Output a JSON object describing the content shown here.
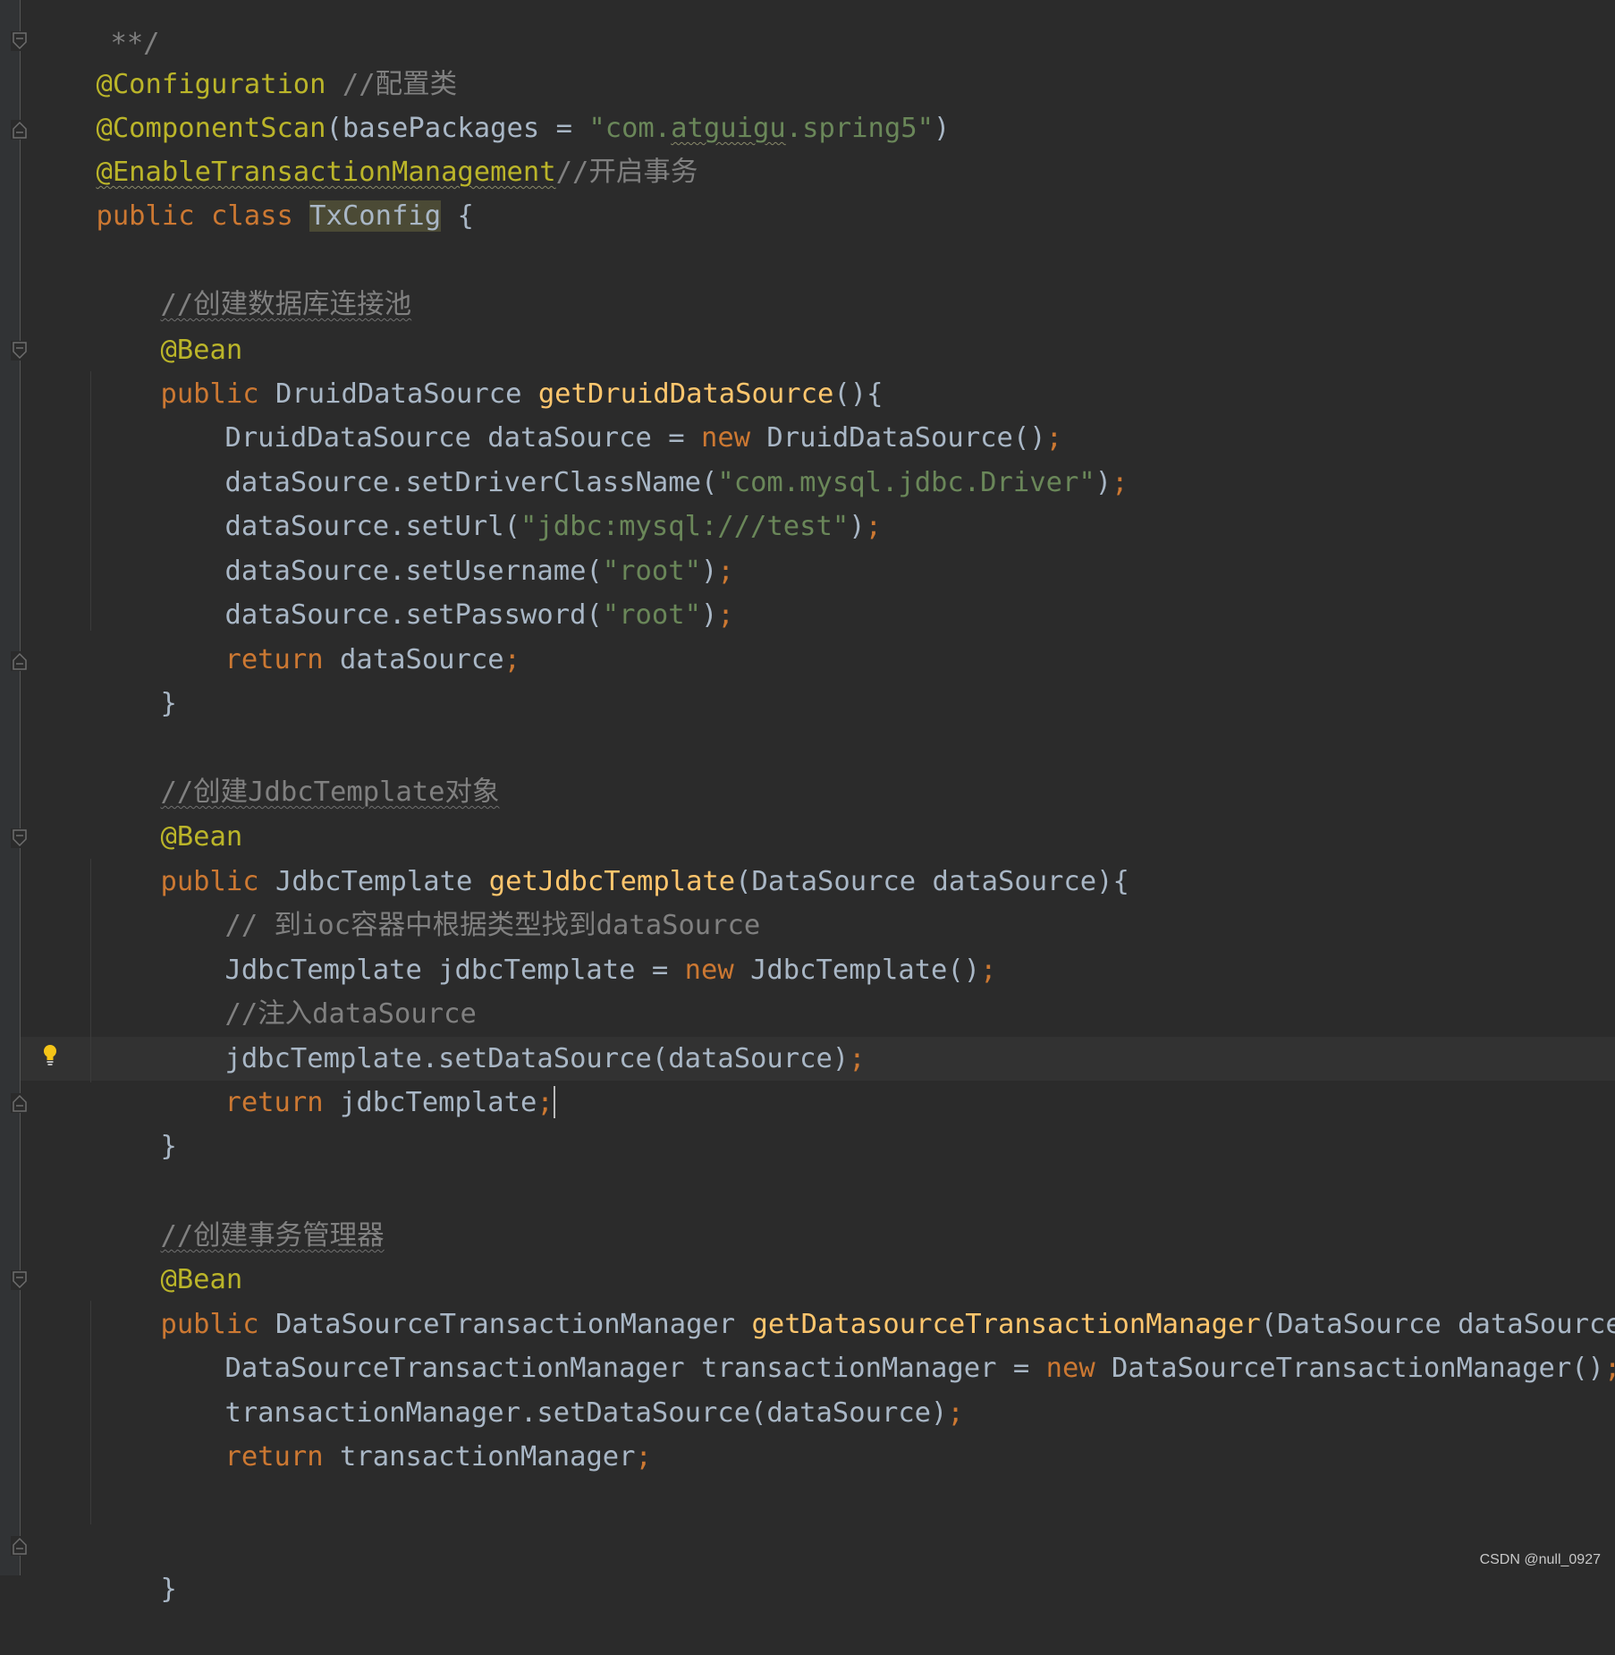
{
  "editor": {
    "language": "Java",
    "theme": "Darcula",
    "lines": {
      "l0": [
        "**/"
      ],
      "l1": [
        "@Configuration",
        " ",
        "//配置类"
      ],
      "l2": [
        "@ComponentScan",
        "(basePackages = ",
        "\"com.",
        "atguigu",
        ".spring5\"",
        ")"
      ],
      "l3": [
        "@EnableTransactionManagement",
        "//开启事务"
      ],
      "l4": [
        "public class ",
        "TxConfig",
        " {"
      ],
      "l6": [
        "//创建数据库连接池"
      ],
      "l7": [
        "@Bean"
      ],
      "l8": [
        "public ",
        "DruidDataSource ",
        "getDruidDataSource",
        "(){"
      ],
      "l9": [
        "DruidDataSource dataSource = ",
        "new ",
        "DruidDataSource()",
        ";"
      ],
      "l10": [
        "dataSource.setDriverClassName(",
        "\"com.mysql.jdbc.Driver\"",
        ")",
        ";"
      ],
      "l11": [
        "dataSource.setUrl(",
        "\"jdbc:mysql:///test\"",
        ")",
        ";"
      ],
      "l12": [
        "dataSource.setUsername(",
        "\"root\"",
        ")",
        ";"
      ],
      "l13": [
        "dataSource.setPassword(",
        "\"root\"",
        ")",
        ";"
      ],
      "l14": [
        "return ",
        "dataSource",
        ";"
      ],
      "l15": [
        "}"
      ],
      "l17": [
        "//创建JdbcTemplate对象"
      ],
      "l18": [
        "@Bean"
      ],
      "l19": [
        "public ",
        "JdbcTemplate ",
        "getJdbcTemplate",
        "(DataSource dataSource){"
      ],
      "l20": [
        "// 到ioc容器中根据类型找到dataSource"
      ],
      "l21": [
        "JdbcTemplate jdbcTemplate = ",
        "new ",
        "JdbcTemplate()",
        ";"
      ],
      "l22": [
        "//注入dataSource"
      ],
      "l23": [
        "jdbcTemplate.setDataSource(dataSource)",
        ";"
      ],
      "l24": [
        "return ",
        "jdbcTemplate",
        ";"
      ],
      "l25": [
        "}"
      ],
      "l27": [
        "//创建事务管理器"
      ],
      "l28": [
        "@Bean"
      ],
      "l29": [
        "public ",
        "DataSourceTransactionManager ",
        "getDatasourceTransactionManager",
        "(DataSource dataSource){"
      ],
      "l30": [
        "DataSourceTransactionManager transactionManager = ",
        "new ",
        "DataSourceTransactionManager()",
        ";"
      ],
      "l31": [
        "transactionManager.setDataSource(dataSource)",
        ";"
      ],
      "l32": [
        "return ",
        "transactionManager",
        ";"
      ],
      "l35": [
        "}"
      ]
    }
  },
  "watermark": "CSDN @null_0927",
  "colors": {
    "background": "#2b2b2b",
    "annotation": "#bbb529",
    "keyword": "#cc7832",
    "string": "#6a8759",
    "comment": "#808080",
    "method": "#ffc66d",
    "text": "#a9b7c6"
  },
  "icons": {
    "bulb": "lightbulb-icon",
    "fold": "fold-marker-icon"
  }
}
